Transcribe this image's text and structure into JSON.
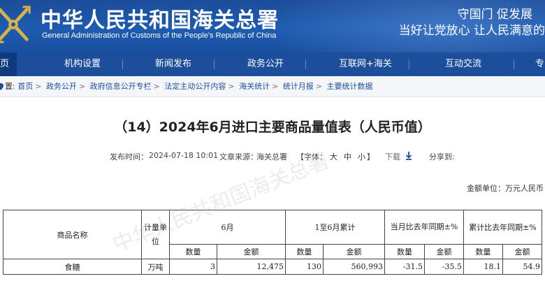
{
  "header": {
    "site_title": "中华人民共和国海关总署",
    "site_subtitle": "General Administration of Customs of the People's Republic of China",
    "slogan_line1": "守国门    促发展",
    "slogan_line2": "当好让党放心    让人民满意的"
  },
  "nav": {
    "items": [
      {
        "label": "页",
        "active": true
      },
      {
        "label": "机构设置"
      },
      {
        "label": "新闻发布"
      },
      {
        "label": "政务公开"
      },
      {
        "label": "互联网+海关"
      },
      {
        "label": "互动交流"
      },
      {
        "label": "专"
      }
    ]
  },
  "breadcrumb": {
    "prefix": "置:",
    "items": [
      "首页",
      "政务公开",
      "政府信息公开专栏",
      "法定主动公开内容",
      "海关统计",
      "统计月报",
      "主要统计数据"
    ],
    "separator": ">"
  },
  "article": {
    "title": "（14）2024年6月进口主要商品量值表（人民币值）",
    "publish_label": "发布时间：",
    "publish_time": "2024-07-18 10:01",
    "source_label": "文章来源：",
    "source": "海关总署",
    "font_label": "【字体：",
    "font_large": "大",
    "font_medium": "中",
    "font_small": "小",
    "font_end": "】",
    "download_label": "下载",
    "share_label": "分享到:",
    "watermark": "中华人民共和国海关总署",
    "unit_note": "金额单位：万元人民币"
  },
  "table": {
    "headers": {
      "name": "商品名称",
      "unit": "计量单位",
      "month": "6月",
      "cumulative": "1至6月累计",
      "month_yoy": "当月比去年同期±%",
      "cum_yoy": "累计比去年同期±%",
      "qty": "数量",
      "amount": "金额"
    },
    "rows": [
      {
        "name": "食糖",
        "unit": "万吨",
        "month_qty": "3",
        "month_amount": "12,475",
        "cum_qty": "130",
        "cum_amount": "560,993",
        "month_qty_yoy": "-31.5",
        "month_amount_yoy": "-35.5",
        "cum_qty_yoy": "18.1",
        "cum_amount_yoy": "54.9"
      }
    ]
  },
  "colors": {
    "banner_blue": "#1e5bb0",
    "nav_blue": "#1c4e9c",
    "nav_active": "#0f3a80",
    "link_blue": "#1a4f9f",
    "download_arrow": "#1a4f9f"
  }
}
